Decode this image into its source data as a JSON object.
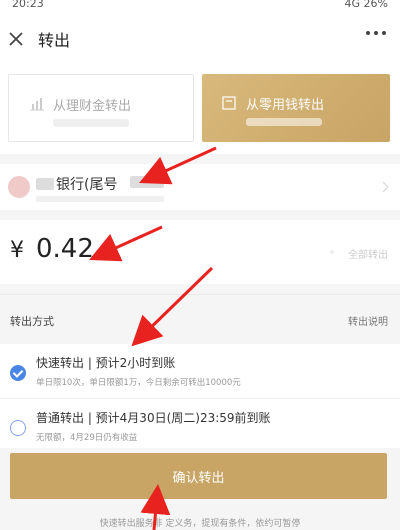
{
  "status_bar": {
    "time": "20:23",
    "right": "4G 26%"
  },
  "nav": {
    "title": "转出"
  },
  "source": {
    "left_label": "从理财金转出",
    "right_label": "从零用钱转出"
  },
  "bank": {
    "name": "银行(尾号"
  },
  "amount": {
    "currency": "¥",
    "value": "0.42",
    "all_label": "全部转出"
  },
  "method": {
    "title": "转出方式",
    "help": "转出说明"
  },
  "options": [
    {
      "title": "快速转出 | 预计2小时到账",
      "desc": "单日限10次，单日限额1万，今日剩余可转出10000元",
      "selected": true
    },
    {
      "title": "普通转出 | 预计4月30日(周二)23:59前到账",
      "desc": "无限额，4月29日仍有收益",
      "selected": false
    }
  ],
  "confirm": {
    "label": "确认转出"
  },
  "footer_note": "快速转出服务非   定义务，提现有条件，依约可暂停",
  "colors": {
    "gold": "#c8a465",
    "radio_blue": "#4a86e8",
    "arrow_red": "#e8221e"
  }
}
